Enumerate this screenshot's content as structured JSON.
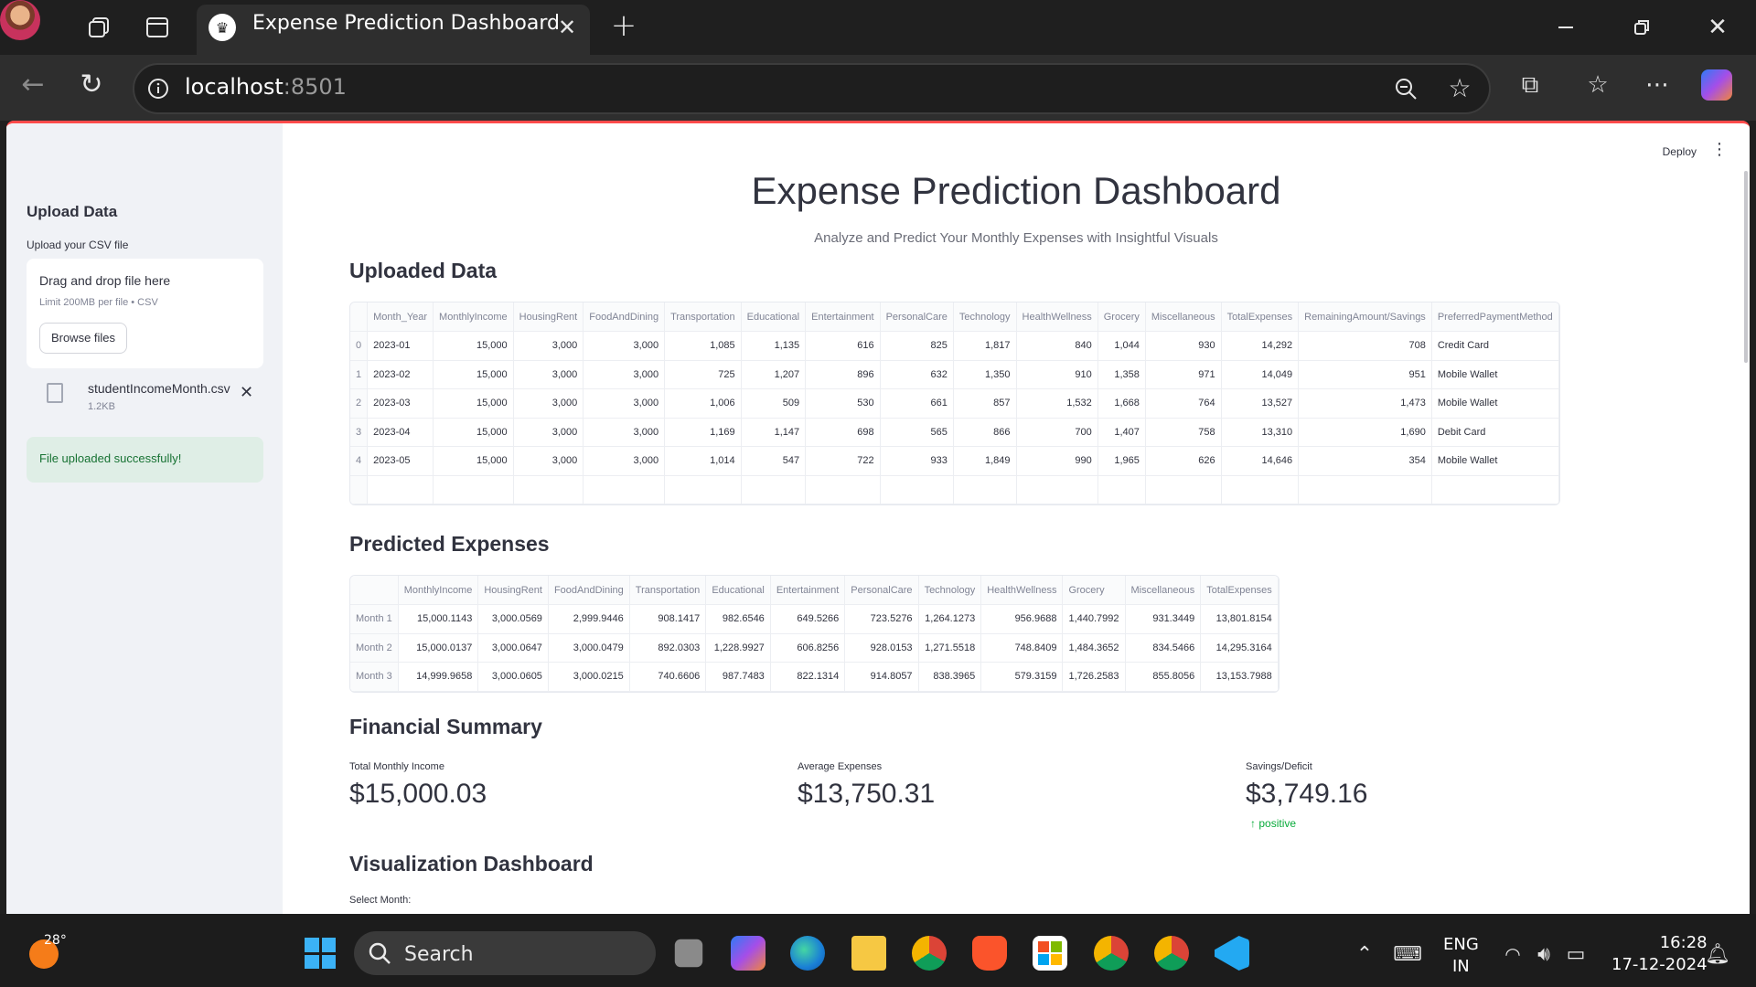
{
  "browser": {
    "tab_title": "Expense Prediction Dashboard",
    "url_host": "localhost",
    "url_port": ":8501"
  },
  "sidebar": {
    "heading": "Upload Data",
    "uploader_label": "Upload your CSV file",
    "dropzone_title": "Drag and drop file here",
    "dropzone_limit": "Limit 200MB per file • CSV",
    "browse_button": "Browse files",
    "file_name": "studentIncomeMonth.csv",
    "file_size": "1.2KB",
    "success_message": "File uploaded successfully!"
  },
  "header": {
    "deploy_label": "Deploy"
  },
  "main": {
    "title": "Expense Prediction Dashboard",
    "subtitle": "Analyze and Predict Your Monthly Expenses with Insightful Visuals",
    "uploaded_heading": "Uploaded Data",
    "predicted_heading": "Predicted Expenses",
    "summary_heading": "Financial Summary",
    "visualization_heading": "Visualization Dashboard",
    "select_month_label": "Select Month:"
  },
  "uploaded_table": {
    "columns": [
      "",
      "Month_Year",
      "MonthlyIncome",
      "HousingRent",
      "FoodAndDining",
      "Transportation",
      "Educational",
      "Entertainment",
      "PersonalCare",
      "Technology",
      "HealthWellness",
      "Grocery",
      "Miscellaneous",
      "TotalExpenses",
      "RemainingAmount/Savings",
      "PreferredPaymentMethod"
    ],
    "rows": [
      [
        "0",
        "2023-01",
        "15,000",
        "3,000",
        "3,000",
        "1,085",
        "1,135",
        "616",
        "825",
        "1,817",
        "840",
        "1,044",
        "930",
        "14,292",
        "708",
        "Credit Card"
      ],
      [
        "1",
        "2023-02",
        "15,000",
        "3,000",
        "3,000",
        "725",
        "1,207",
        "896",
        "632",
        "1,350",
        "910",
        "1,358",
        "971",
        "14,049",
        "951",
        "Mobile Wallet"
      ],
      [
        "2",
        "2023-03",
        "15,000",
        "3,000",
        "3,000",
        "1,006",
        "509",
        "530",
        "661",
        "857",
        "1,532",
        "1,668",
        "764",
        "13,527",
        "1,473",
        "Mobile Wallet"
      ],
      [
        "3",
        "2023-04",
        "15,000",
        "3,000",
        "3,000",
        "1,169",
        "1,147",
        "698",
        "565",
        "866",
        "700",
        "1,407",
        "758",
        "13,310",
        "1,690",
        "Debit Card"
      ],
      [
        "4",
        "2023-05",
        "15,000",
        "3,000",
        "3,000",
        "1,014",
        "547",
        "722",
        "933",
        "1,849",
        "990",
        "1,965",
        "626",
        "14,646",
        "354",
        "Mobile Wallet"
      ]
    ]
  },
  "predicted_table": {
    "columns": [
      "",
      "MonthlyIncome",
      "HousingRent",
      "FoodAndDining",
      "Transportation",
      "Educational",
      "Entertainment",
      "PersonalCare",
      "Technology",
      "HealthWellness",
      "Grocery",
      "Miscellaneous",
      "TotalExpenses"
    ],
    "rows": [
      [
        "Month 1",
        "15,000.1143",
        "3,000.0569",
        "2,999.9446",
        "908.1417",
        "982.6546",
        "649.5266",
        "723.5276",
        "1,264.1273",
        "956.9688",
        "1,440.7992",
        "931.3449",
        "13,801.8154"
      ],
      [
        "Month 2",
        "15,000.0137",
        "3,000.0647",
        "3,000.0479",
        "892.0303",
        "1,228.9927",
        "606.8256",
        "928.0153",
        "1,271.5518",
        "748.8409",
        "1,484.3652",
        "834.5466",
        "14,295.3164"
      ],
      [
        "Month 3",
        "14,999.9658",
        "3,000.0605",
        "3,000.0215",
        "740.6606",
        "987.7483",
        "822.1314",
        "914.8057",
        "838.3965",
        "579.3159",
        "1,726.2583",
        "855.8056",
        "13,153.7988"
      ]
    ]
  },
  "summary": {
    "income_label": "Total Monthly Income",
    "income_value": "$15,000.03",
    "expenses_label": "Average Expenses",
    "expenses_value": "$13,750.31",
    "savings_label": "Savings/Deficit",
    "savings_value": "$3,749.16",
    "savings_delta": "positive"
  },
  "taskbar": {
    "temperature": "28°",
    "search_text": "Search",
    "lang_line1": "ENG",
    "lang_line2": "IN",
    "time": "16:28",
    "date": "17-12-2024"
  },
  "colors": {
    "accent": "#ff4b4b",
    "success_bg": "#dfeee6",
    "success_text": "#177233",
    "delta_positive": "#09ab3b"
  }
}
